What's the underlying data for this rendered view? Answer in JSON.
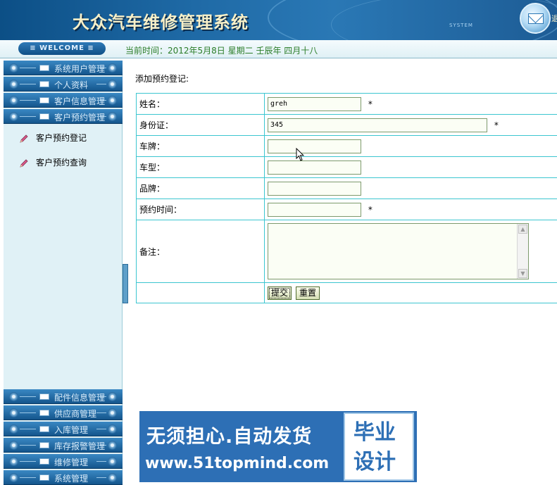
{
  "header": {
    "title": "大众汽车维修管理系统",
    "system_word": "SYSTEM",
    "corner_char": "退"
  },
  "bar": {
    "welcome": "≡ WELCOME ≡",
    "date": "当前时间：2012年5月8日 星期二 壬辰年 四月十八"
  },
  "sidebar": {
    "top_menu": [
      {
        "label": "系统用户管理"
      },
      {
        "label": "个人资料"
      },
      {
        "label": "客户信息管理"
      },
      {
        "label": "客户预约管理"
      }
    ],
    "sub_items": [
      {
        "label": "客户预约登记"
      },
      {
        "label": "客户预约查询"
      }
    ],
    "bottom_menu": [
      {
        "label": "配件信息管理"
      },
      {
        "label": "供应商管理"
      },
      {
        "label": "入库管理"
      },
      {
        "label": "库存报警管理"
      },
      {
        "label": "维修管理"
      },
      {
        "label": "系统管理"
      }
    ]
  },
  "form": {
    "caption": "添加预约登记:",
    "fields": {
      "name": {
        "label": "姓名：",
        "value": "greh",
        "required": "*"
      },
      "id_card": {
        "label": "身份证：",
        "value": "345",
        "required": "*"
      },
      "plate": {
        "label": "车牌：",
        "value": ""
      },
      "model": {
        "label": "车型：",
        "value": ""
      },
      "brand": {
        "label": "品牌：",
        "value": ""
      },
      "appointment_time": {
        "label": "预约时间：",
        "value": "",
        "required": "*"
      },
      "remarks": {
        "label": "备注：",
        "value": ""
      }
    },
    "submit_label": "提交",
    "reset_label": "重置"
  },
  "promo": {
    "line1": "无须担心.自动发货",
    "line2": "www.51topmind.com",
    "box_line1": "毕业",
    "box_line2": "设计"
  },
  "colors": {
    "header_blue": "#1f6aa6",
    "table_border": "#3cc6d0",
    "date_green": "#2b7d28",
    "promo_blue": "#2d6fb5"
  }
}
